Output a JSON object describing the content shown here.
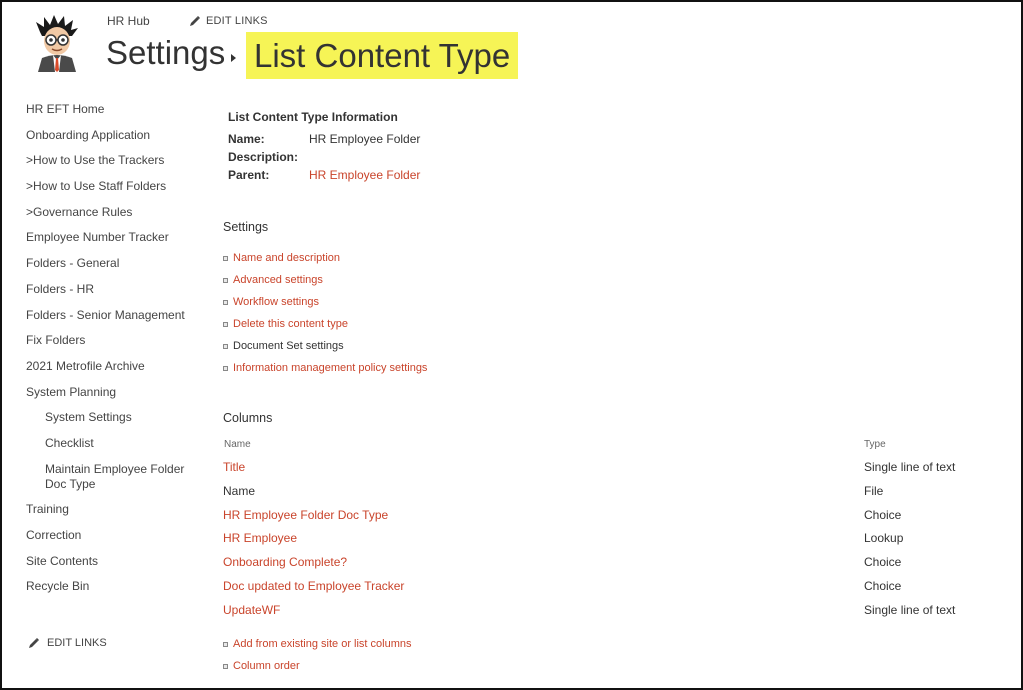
{
  "header": {
    "site_name": "HR Hub",
    "edit_links": "EDIT LINKS",
    "breadcrumb_parent": "Settings",
    "breadcrumb_current": "List Content Type"
  },
  "leftnav": {
    "items": [
      {
        "label": "HR EFT Home",
        "sub": false
      },
      {
        "label": "Onboarding Application",
        "sub": false
      },
      {
        "label": ">How to Use the Trackers",
        "sub": false
      },
      {
        "label": ">How to Use Staff Folders",
        "sub": false
      },
      {
        "label": ">Governance Rules",
        "sub": false
      },
      {
        "label": "Employee Number Tracker",
        "sub": false
      },
      {
        "label": "Folders - General",
        "sub": false
      },
      {
        "label": "Folders - HR",
        "sub": false
      },
      {
        "label": "Folders - Senior Management",
        "sub": false
      },
      {
        "label": "Fix Folders",
        "sub": false
      },
      {
        "label": "2021 Metrofile Archive",
        "sub": false
      },
      {
        "label": "System Planning",
        "sub": false
      },
      {
        "label": "System Settings",
        "sub": true
      },
      {
        "label": "Checklist",
        "sub": true
      },
      {
        "label": "Maintain Employee Folder Doc Type",
        "sub": true
      },
      {
        "label": "Training",
        "sub": false
      },
      {
        "label": "Correction",
        "sub": false
      },
      {
        "label": "Site Contents",
        "sub": false
      },
      {
        "label": "Recycle Bin",
        "sub": false
      }
    ],
    "edit_links": "EDIT LINKS"
  },
  "info": {
    "title": "List Content Type Information",
    "name_label": "Name:",
    "name_value": "HR Employee Folder",
    "description_label": "Description:",
    "description_value": "",
    "parent_label": "Parent:",
    "parent_value": "HR Employee Folder"
  },
  "settings": {
    "heading": "Settings",
    "items": [
      {
        "label": "Name and description",
        "link": true
      },
      {
        "label": "Advanced settings",
        "link": true
      },
      {
        "label": "Workflow settings",
        "link": true
      },
      {
        "label": "Delete this content type",
        "link": true
      },
      {
        "label": "Document Set settings",
        "link": false
      },
      {
        "label": "Information management policy settings",
        "link": true
      }
    ]
  },
  "columns": {
    "heading": "Columns",
    "header_name": "Name",
    "header_type": "Type",
    "rows": [
      {
        "name": "Title",
        "type": "Single line of text",
        "link": true
      },
      {
        "name": "Name",
        "type": "File",
        "link": false
      },
      {
        "name": "HR Employee Folder Doc Type",
        "type": "Choice",
        "link": true
      },
      {
        "name": "HR Employee",
        "type": "Lookup",
        "link": true
      },
      {
        "name": "Onboarding Complete?",
        "type": "Choice",
        "link": true
      },
      {
        "name": "Doc updated to Employee Tracker",
        "type": "Choice",
        "link": true
      },
      {
        "name": "UpdateWF",
        "type": "Single line of text",
        "link": true
      }
    ],
    "actions": [
      {
        "label": "Add from existing site or list columns"
      },
      {
        "label": "Column order"
      }
    ]
  },
  "colors": {
    "link": "#c9442b",
    "highlight": "#f6f456"
  }
}
